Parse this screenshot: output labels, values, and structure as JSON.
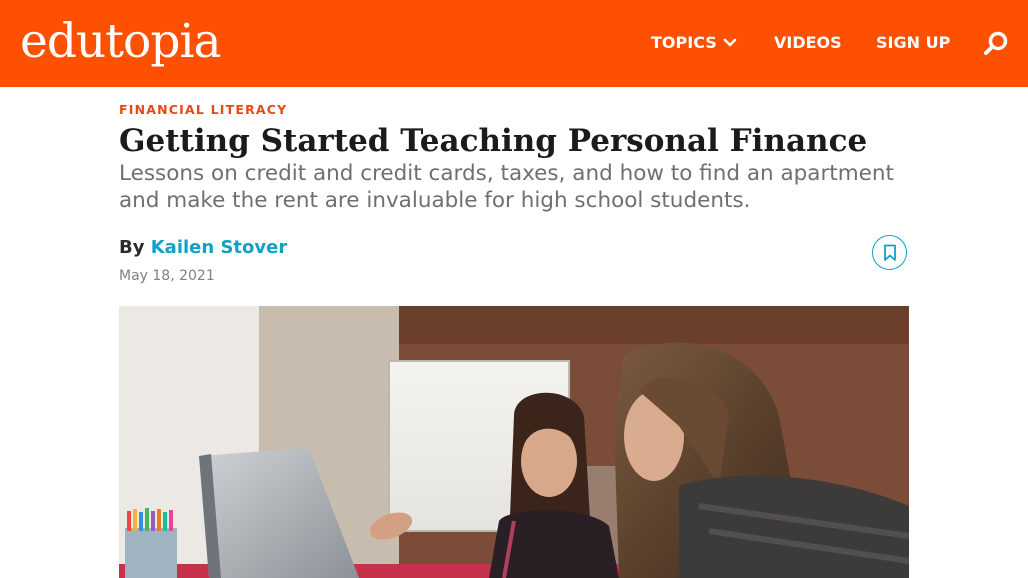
{
  "header": {
    "logo": "edutopia",
    "nav": {
      "topics": "TOPICS",
      "videos": "VIDEOS",
      "signup": "SIGN UP"
    }
  },
  "article": {
    "category": "FINANCIAL LITERACY",
    "title": "Getting Started Teaching Personal Finance",
    "dek": "Lessons on credit and credit cards, taxes, and how to find an apartment and make the rent are invaluable for high school students.",
    "by_prefix": "By",
    "author": "Kailen Stover",
    "date": "May 18, 2021"
  },
  "colors": {
    "brand": "#fd5000",
    "accent": "#10a2c6",
    "category": "#e8471a"
  },
  "icons": {
    "topics_chevron": "chevron-down-icon",
    "search": "search-icon",
    "bookmark": "bookmark-icon"
  }
}
